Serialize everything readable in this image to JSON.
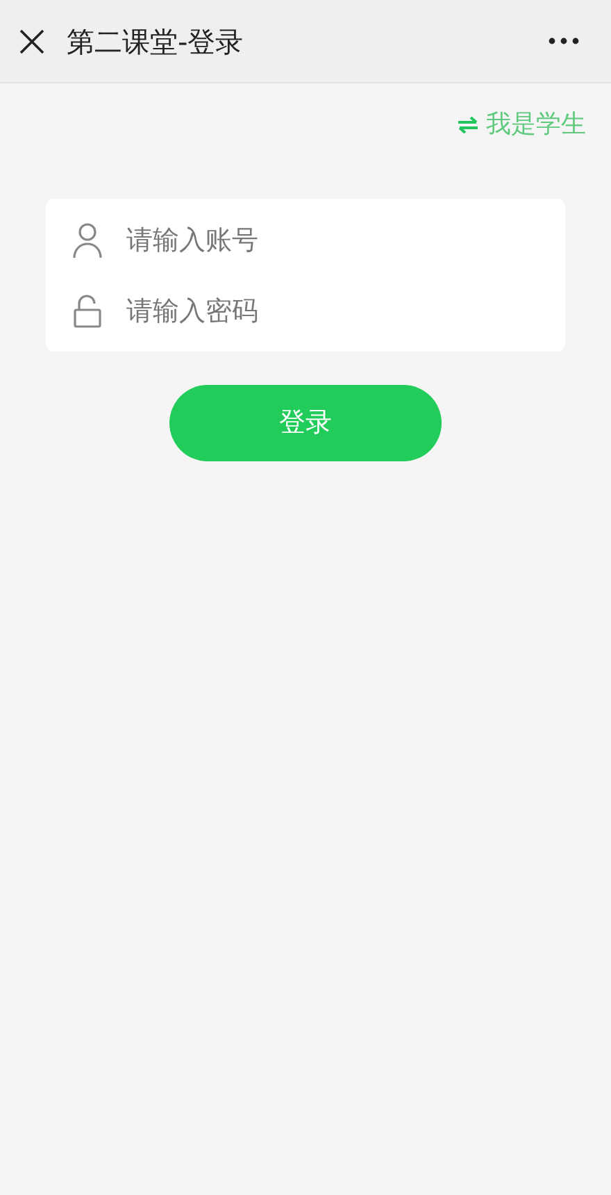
{
  "window": {
    "title": "第二课堂-登录"
  },
  "role_switch": {
    "label": "我是学生"
  },
  "fields": [
    {
      "kind": "account",
      "placeholder": "请输入账号"
    },
    {
      "kind": "password",
      "placeholder": "请输入密码"
    }
  ],
  "login_button": {
    "label": "登录"
  }
}
